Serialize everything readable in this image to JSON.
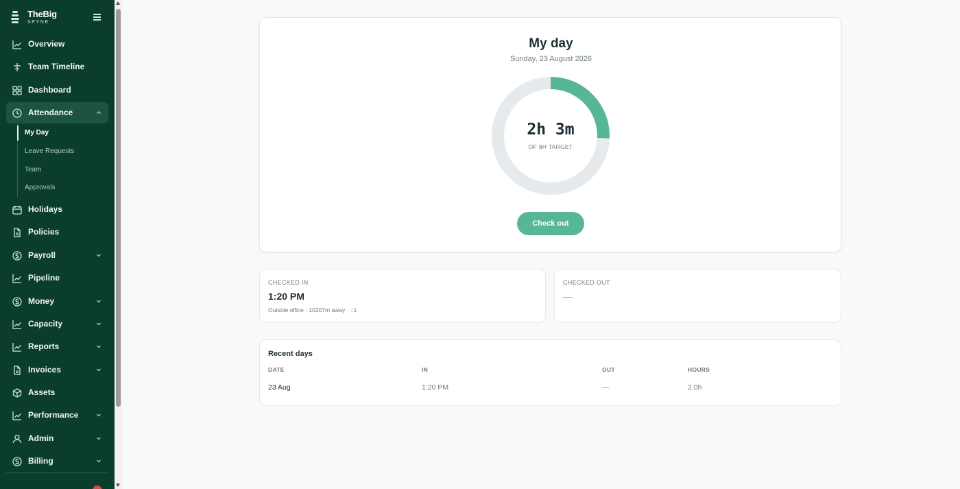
{
  "brand": {
    "name": "TheBig",
    "sub": "SPYNE"
  },
  "sidebar": {
    "items": [
      {
        "label": "Overview",
        "icon": "trend-icon"
      },
      {
        "label": "Team Timeline",
        "icon": "timeline-icon"
      },
      {
        "label": "Dashboard",
        "icon": "grid-icon"
      },
      {
        "label": "Attendance",
        "icon": "clock-icon",
        "expanded": true
      },
      {
        "label": "Holidays",
        "icon": "calendar-icon"
      },
      {
        "label": "Policies",
        "icon": "document-icon"
      },
      {
        "label": "Payroll",
        "icon": "dollar-icon"
      },
      {
        "label": "Pipeline",
        "icon": "trend-icon"
      },
      {
        "label": "Money",
        "icon": "dollar-icon"
      },
      {
        "label": "Capacity",
        "icon": "trend-icon"
      },
      {
        "label": "Reports",
        "icon": "trend-icon"
      },
      {
        "label": "Invoices",
        "icon": "document-icon"
      },
      {
        "label": "Assets",
        "icon": "box-icon"
      },
      {
        "label": "Performance",
        "icon": "trend-icon"
      },
      {
        "label": "Admin",
        "icon": "user-icon"
      },
      {
        "label": "Billing",
        "icon": "dollar-icon"
      }
    ],
    "attendance_sub": [
      {
        "label": "My Day",
        "active": true
      },
      {
        "label": "Leave Requests"
      },
      {
        "label": "Team"
      },
      {
        "label": "Approvals"
      }
    ]
  },
  "myday": {
    "title": "My day",
    "date": "Sunday, 23 August 2026",
    "worked": "2h 3m",
    "target_caption": "OF 8H TARGET",
    "progress_fraction": 0.257,
    "checkout_label": "Check out"
  },
  "checked_in": {
    "label": "CHECKED IN",
    "value": "1:20 PM",
    "note": "Outside office · 10207m away · ::1"
  },
  "checked_out": {
    "label": "CHECKED OUT",
    "value": "—"
  },
  "recent": {
    "title": "Recent days",
    "headers": [
      "DATE",
      "IN",
      "OUT",
      "HOURS"
    ],
    "rows": [
      [
        "23 Aug",
        "1:20 PM",
        "—",
        "2.0h"
      ]
    ]
  },
  "colors": {
    "sidebar": "#0b3d2c",
    "accent": "#56b697",
    "ring_track": "#e6eaed"
  }
}
